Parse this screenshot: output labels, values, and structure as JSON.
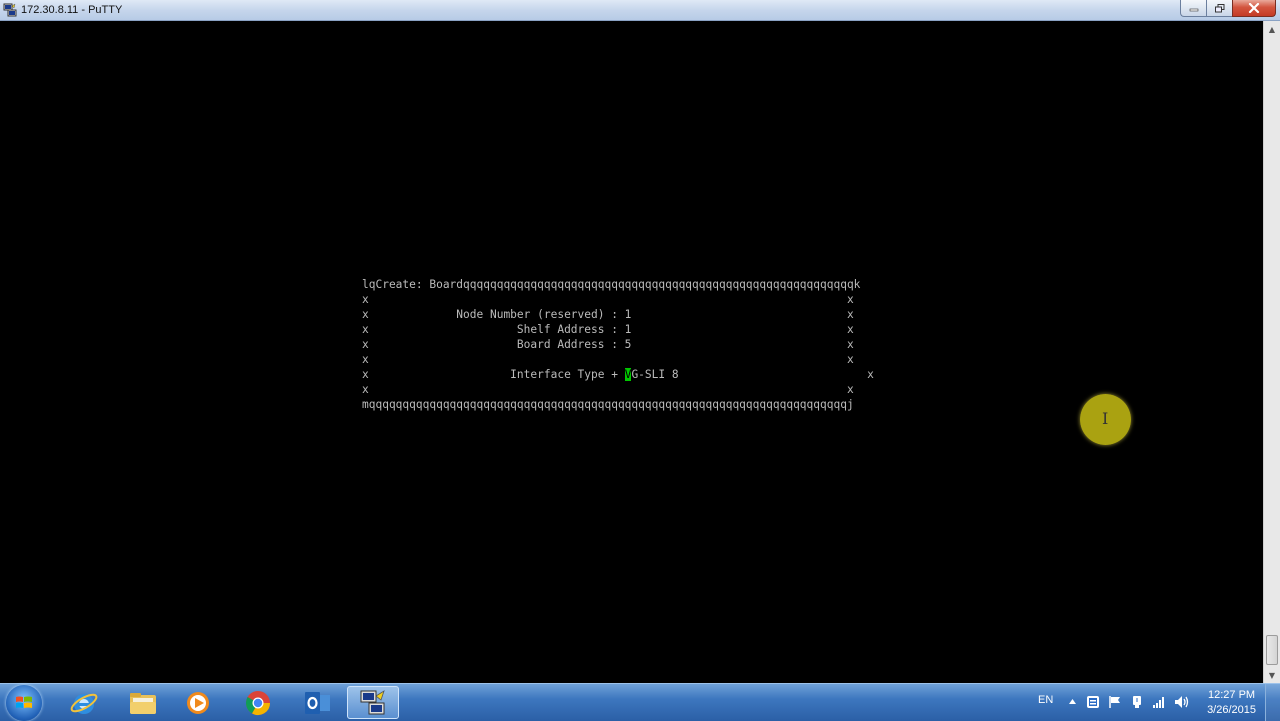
{
  "window": {
    "title": "172.30.8.11 - PuTTY"
  },
  "terminal": {
    "lines": [
      [
        {
          "t": "lqCreate: Boardqqqqqqqqqqqqqqqqqqqqqqqqqqqqqqqqqqqqqqqqqqqqqqqqqqqqqqqqqqk"
        }
      ],
      [
        {
          "t": "x                                                                       x"
        }
      ],
      [
        {
          "t": "x             Node Number (reserved) : 1                                x"
        }
      ],
      [
        {
          "t": "x                      Shelf Address : 1                                x"
        }
      ],
      [
        {
          "t": "x                      Board Address : 5                                x"
        }
      ],
      [
        {
          "t": "x                                                                       x"
        }
      ],
      [
        {
          "t": "x                     Interface Type + "
        },
        {
          "t": "V",
          "c": "cursor"
        },
        {
          "t": "G-SLI 8                            x"
        }
      ],
      [
        {
          "t": "x                                                                       x"
        }
      ],
      [
        {
          "t": "mqqqqqqqqqqqqqqqqqqqqqqqqqqqqqqqqqqqqqqqqqqqqqqqqqqqqqqqqqqqqqqqqqqqqqqqj"
        }
      ]
    ]
  },
  "taskbar": {
    "apps": [
      {
        "name": "internet-explorer-icon"
      },
      {
        "name": "file-explorer-icon"
      },
      {
        "name": "media-player-icon"
      },
      {
        "name": "chrome-icon"
      },
      {
        "name": "outlook-icon"
      },
      {
        "name": "putty-icon",
        "active": true
      }
    ],
    "tray": {
      "language": "EN"
    },
    "clock": {
      "time": "12:27 PM",
      "date": "3/26/2015"
    }
  },
  "colors": {
    "terminal_bg": "#000000",
    "terminal_fg": "#bbbbbb",
    "cursor": "#00c800",
    "highlight": "#c8be14"
  }
}
